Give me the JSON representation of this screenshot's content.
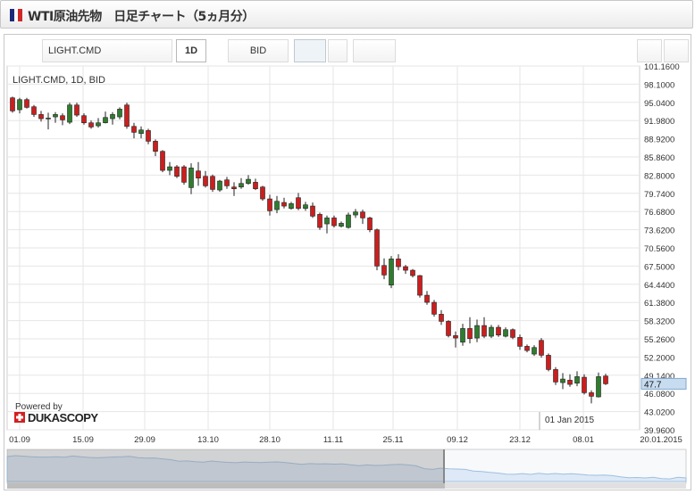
{
  "window": {
    "title": "WTI原油先物　日足チャート（5ヵ月分）",
    "flag_colors": [
      "#1d2a7a",
      "#ffffff",
      "#d22828"
    ]
  },
  "toolbar": {
    "symbol_value": "LIGHT.CMD",
    "period_label": "1D",
    "side_label": "BID"
  },
  "chart_label": "LIGHT.CMD, 1D, BID",
  "branding": {
    "powered_by": "Powered by",
    "logo_text": "DUKASCOPY"
  },
  "date_annotation": "01 Jan 2015",
  "colors": {
    "up": "#2e7d2e",
    "down": "#cc1e1e",
    "grid": "#e6e6e6",
    "price_tag_bg": "#c8dcf0",
    "nav_fill": "#dde9f6"
  },
  "chart_data": {
    "type": "candlestick",
    "symbol": "LIGHT.CMD",
    "timeframe": "1D",
    "side": "BID",
    "y_ticks": [
      "101.1600",
      "98.1000",
      "95.0400",
      "91.9800",
      "88.9200",
      "85.8600",
      "82.8000",
      "79.7400",
      "76.6800",
      "73.6200",
      "70.5600",
      "67.5000",
      "64.4400",
      "61.3800",
      "58.3200",
      "55.2600",
      "52.2000",
      "49.1400",
      "46.0800",
      "43.0200",
      "39.9600"
    ],
    "ylim": [
      39.96,
      101.16
    ],
    "x_ticks": [
      "01.09",
      "15.09",
      "29.09",
      "13.10",
      "28.10",
      "11.11",
      "25.11",
      "09.12",
      "23.12",
      "08.01",
      "20.01.2015"
    ],
    "last_price": "47.7",
    "candles": [
      {
        "o": 95.8,
        "h": 96.0,
        "l": 93.3,
        "c": 93.6
      },
      {
        "o": 93.8,
        "h": 95.8,
        "l": 93.2,
        "c": 95.5
      },
      {
        "o": 95.5,
        "h": 95.8,
        "l": 94.0,
        "c": 94.2
      },
      {
        "o": 94.3,
        "h": 94.6,
        "l": 92.6,
        "c": 93.0
      },
      {
        "o": 93.0,
        "h": 93.6,
        "l": 91.8,
        "c": 92.3
      },
      {
        "o": 92.3,
        "h": 93.3,
        "l": 90.5,
        "c": 92.4
      },
      {
        "o": 92.6,
        "h": 93.4,
        "l": 91.6,
        "c": 93.0
      },
      {
        "o": 92.8,
        "h": 93.2,
        "l": 91.2,
        "c": 92.1
      },
      {
        "o": 91.7,
        "h": 95.0,
        "l": 91.4,
        "c": 94.6
      },
      {
        "o": 94.6,
        "h": 95.0,
        "l": 92.6,
        "c": 92.9
      },
      {
        "o": 92.8,
        "h": 93.2,
        "l": 91.3,
        "c": 91.6
      },
      {
        "o": 91.6,
        "h": 92.0,
        "l": 90.6,
        "c": 90.9
      },
      {
        "o": 91.1,
        "h": 92.4,
        "l": 90.8,
        "c": 91.6
      },
      {
        "o": 91.6,
        "h": 93.5,
        "l": 91.5,
        "c": 92.5
      },
      {
        "o": 92.3,
        "h": 93.4,
        "l": 91.3,
        "c": 93.0
      },
      {
        "o": 92.6,
        "h": 94.2,
        "l": 92.2,
        "c": 93.9
      },
      {
        "o": 94.6,
        "h": 95.0,
        "l": 90.6,
        "c": 91.0
      },
      {
        "o": 91.0,
        "h": 91.6,
        "l": 89.0,
        "c": 90.0
      },
      {
        "o": 89.8,
        "h": 91.0,
        "l": 89.0,
        "c": 90.4
      },
      {
        "o": 90.3,
        "h": 90.6,
        "l": 88.0,
        "c": 88.5
      },
      {
        "o": 88.5,
        "h": 88.8,
        "l": 86.0,
        "c": 86.8
      },
      {
        "o": 86.8,
        "h": 87.0,
        "l": 83.3,
        "c": 83.6
      },
      {
        "o": 83.6,
        "h": 85.0,
        "l": 82.8,
        "c": 84.2
      },
      {
        "o": 84.2,
        "h": 84.5,
        "l": 82.3,
        "c": 82.6
      },
      {
        "o": 84.2,
        "h": 84.5,
        "l": 81.2,
        "c": 81.6
      },
      {
        "o": 80.7,
        "h": 84.8,
        "l": 79.6,
        "c": 84.0
      },
      {
        "o": 83.5,
        "h": 85.0,
        "l": 81.0,
        "c": 82.3
      },
      {
        "o": 82.6,
        "h": 83.5,
        "l": 80.7,
        "c": 81.0
      },
      {
        "o": 82.6,
        "h": 82.9,
        "l": 80.0,
        "c": 80.4
      },
      {
        "o": 80.3,
        "h": 82.0,
        "l": 80.0,
        "c": 81.8
      },
      {
        "o": 82.0,
        "h": 82.5,
        "l": 80.5,
        "c": 81.0
      },
      {
        "o": 80.8,
        "h": 81.6,
        "l": 79.3,
        "c": 80.5
      },
      {
        "o": 80.8,
        "h": 82.3,
        "l": 80.5,
        "c": 81.4
      },
      {
        "o": 81.4,
        "h": 82.8,
        "l": 81.2,
        "c": 82.1
      },
      {
        "o": 81.6,
        "h": 82.2,
        "l": 80.3,
        "c": 80.5
      },
      {
        "o": 80.8,
        "h": 81.0,
        "l": 78.5,
        "c": 78.8
      },
      {
        "o": 78.8,
        "h": 79.5,
        "l": 76.0,
        "c": 76.8
      },
      {
        "o": 77.0,
        "h": 79.3,
        "l": 76.4,
        "c": 78.4
      },
      {
        "o": 78.2,
        "h": 79.0,
        "l": 77.2,
        "c": 77.6
      },
      {
        "o": 77.2,
        "h": 78.3,
        "l": 77.0,
        "c": 78.0
      },
      {
        "o": 79.0,
        "h": 79.8,
        "l": 76.9,
        "c": 77.2
      },
      {
        "o": 77.2,
        "h": 78.3,
        "l": 76.8,
        "c": 77.8
      },
      {
        "o": 77.6,
        "h": 78.2,
        "l": 75.6,
        "c": 75.9
      },
      {
        "o": 76.2,
        "h": 76.5,
        "l": 73.6,
        "c": 74.0
      },
      {
        "o": 74.6,
        "h": 76.0,
        "l": 73.0,
        "c": 75.6
      },
      {
        "o": 75.6,
        "h": 76.0,
        "l": 74.0,
        "c": 74.3
      },
      {
        "o": 74.2,
        "h": 75.0,
        "l": 74.0,
        "c": 74.7
      },
      {
        "o": 74.0,
        "h": 76.5,
        "l": 73.8,
        "c": 76.1
      },
      {
        "o": 76.1,
        "h": 77.1,
        "l": 75.6,
        "c": 76.6
      },
      {
        "o": 76.6,
        "h": 77.0,
        "l": 74.6,
        "c": 75.6
      },
      {
        "o": 75.6,
        "h": 75.8,
        "l": 73.2,
        "c": 73.6
      },
      {
        "o": 73.6,
        "h": 73.8,
        "l": 66.8,
        "c": 67.5
      },
      {
        "o": 67.6,
        "h": 68.8,
        "l": 65.3,
        "c": 66.0
      },
      {
        "o": 64.3,
        "h": 69.2,
        "l": 63.8,
        "c": 68.7
      },
      {
        "o": 68.7,
        "h": 69.5,
        "l": 66.8,
        "c": 67.4
      },
      {
        "o": 67.4,
        "h": 67.7,
        "l": 66.2,
        "c": 66.8
      },
      {
        "o": 66.8,
        "h": 67.0,
        "l": 65.6,
        "c": 65.9
      },
      {
        "o": 65.9,
        "h": 66.0,
        "l": 62.2,
        "c": 62.6
      },
      {
        "o": 62.6,
        "h": 63.3,
        "l": 61.0,
        "c": 61.4
      },
      {
        "o": 61.4,
        "h": 61.8,
        "l": 59.0,
        "c": 59.4
      },
      {
        "o": 59.4,
        "h": 60.1,
        "l": 57.6,
        "c": 58.2
      },
      {
        "o": 58.2,
        "h": 58.4,
        "l": 55.5,
        "c": 55.8
      },
      {
        "o": 55.8,
        "h": 56.5,
        "l": 53.8,
        "c": 55.4
      },
      {
        "o": 54.7,
        "h": 57.8,
        "l": 54.1,
        "c": 57.0
      },
      {
        "o": 57.0,
        "h": 58.9,
        "l": 54.5,
        "c": 55.3
      },
      {
        "o": 55.4,
        "h": 58.5,
        "l": 54.7,
        "c": 57.5
      },
      {
        "o": 57.5,
        "h": 58.9,
        "l": 55.4,
        "c": 55.7
      },
      {
        "o": 55.7,
        "h": 57.6,
        "l": 55.4,
        "c": 57.2
      },
      {
        "o": 57.2,
        "h": 57.6,
        "l": 55.6,
        "c": 55.9
      },
      {
        "o": 55.7,
        "h": 57.2,
        "l": 55.5,
        "c": 56.8
      },
      {
        "o": 56.8,
        "h": 57.0,
        "l": 55.2,
        "c": 55.5
      },
      {
        "o": 55.5,
        "h": 56.0,
        "l": 53.4,
        "c": 54.0
      },
      {
        "o": 54.0,
        "h": 54.3,
        "l": 53.0,
        "c": 53.3
      },
      {
        "o": 52.7,
        "h": 54.2,
        "l": 52.4,
        "c": 53.8
      },
      {
        "o": 55.0,
        "h": 55.4,
        "l": 52.1,
        "c": 52.5
      },
      {
        "o": 52.5,
        "h": 52.8,
        "l": 49.8,
        "c": 50.1
      },
      {
        "o": 50.1,
        "h": 50.5,
        "l": 47.5,
        "c": 48.0
      },
      {
        "o": 47.9,
        "h": 49.5,
        "l": 46.8,
        "c": 48.5
      },
      {
        "o": 48.3,
        "h": 49.3,
        "l": 47.2,
        "c": 47.6
      },
      {
        "o": 47.8,
        "h": 49.8,
        "l": 47.3,
        "c": 48.9
      },
      {
        "o": 48.8,
        "h": 49.3,
        "l": 45.9,
        "c": 46.2
      },
      {
        "o": 46.2,
        "h": 46.6,
        "l": 44.4,
        "c": 45.6
      },
      {
        "o": 45.5,
        "h": 49.6,
        "l": 45.4,
        "c": 48.9
      },
      {
        "o": 49.0,
        "h": 49.4,
        "l": 47.5,
        "c": 47.7
      }
    ]
  }
}
